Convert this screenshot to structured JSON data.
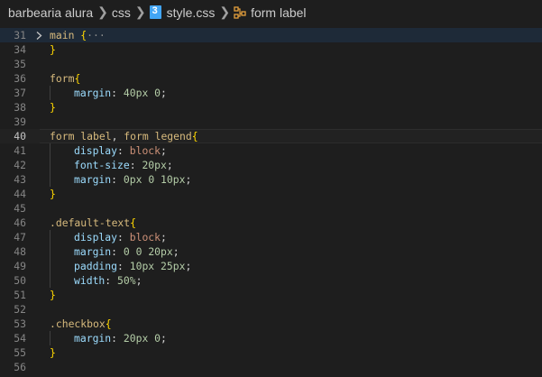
{
  "breadcrumb": {
    "folder": "barbearia alura",
    "subfolder": "css",
    "file": "style.css",
    "symbol": "form label"
  },
  "editor": {
    "lines": [
      {
        "n": "31",
        "folded": true,
        "tokens": [
          [
            "sel",
            "main"
          ],
          [
            "punc",
            " "
          ],
          [
            "br",
            "{"
          ],
          [
            "ell",
            "···"
          ]
        ]
      },
      {
        "n": "34",
        "tokens": [
          [
            "br",
            "}"
          ]
        ]
      },
      {
        "n": "35",
        "tokens": []
      },
      {
        "n": "36",
        "tokens": [
          [
            "sel",
            "form"
          ],
          [
            "br",
            "{"
          ]
        ]
      },
      {
        "n": "37",
        "indent": 1,
        "tokens": [
          [
            "prop",
            "margin"
          ],
          [
            "punc",
            ": "
          ],
          [
            "num",
            "40px"
          ],
          [
            "punc",
            " "
          ],
          [
            "num",
            "0"
          ],
          [
            "punc",
            ";"
          ]
        ]
      },
      {
        "n": "38",
        "tokens": [
          [
            "br",
            "}"
          ]
        ]
      },
      {
        "n": "39",
        "tokens": []
      },
      {
        "n": "40",
        "current": true,
        "tokens": [
          [
            "sel",
            "form label"
          ],
          [
            "punc",
            ", "
          ],
          [
            "sel",
            "form legend"
          ],
          [
            "br",
            "{"
          ]
        ]
      },
      {
        "n": "41",
        "indent": 1,
        "tokens": [
          [
            "prop",
            "display"
          ],
          [
            "punc",
            ": "
          ],
          [
            "val",
            "block"
          ],
          [
            "punc",
            ";"
          ]
        ]
      },
      {
        "n": "42",
        "indent": 1,
        "tokens": [
          [
            "prop",
            "font-size"
          ],
          [
            "punc",
            ": "
          ],
          [
            "num",
            "20px"
          ],
          [
            "punc",
            ";"
          ]
        ]
      },
      {
        "n": "43",
        "indent": 1,
        "tokens": [
          [
            "prop",
            "margin"
          ],
          [
            "punc",
            ": "
          ],
          [
            "num",
            "0px"
          ],
          [
            "punc",
            " "
          ],
          [
            "num",
            "0"
          ],
          [
            "punc",
            " "
          ],
          [
            "num",
            "10px"
          ],
          [
            "punc",
            ";"
          ]
        ]
      },
      {
        "n": "44",
        "tokens": [
          [
            "br",
            "}"
          ]
        ]
      },
      {
        "n": "45",
        "tokens": []
      },
      {
        "n": "46",
        "tokens": [
          [
            "sel",
            ".default-text"
          ],
          [
            "br",
            "{"
          ]
        ]
      },
      {
        "n": "47",
        "indent": 1,
        "tokens": [
          [
            "prop",
            "display"
          ],
          [
            "punc",
            ": "
          ],
          [
            "val",
            "block"
          ],
          [
            "punc",
            ";"
          ]
        ]
      },
      {
        "n": "48",
        "indent": 1,
        "tokens": [
          [
            "prop",
            "margin"
          ],
          [
            "punc",
            ": "
          ],
          [
            "num",
            "0"
          ],
          [
            "punc",
            " "
          ],
          [
            "num",
            "0"
          ],
          [
            "punc",
            " "
          ],
          [
            "num",
            "20px"
          ],
          [
            "punc",
            ";"
          ]
        ]
      },
      {
        "n": "49",
        "indent": 1,
        "tokens": [
          [
            "prop",
            "padding"
          ],
          [
            "punc",
            ": "
          ],
          [
            "num",
            "10px"
          ],
          [
            "punc",
            " "
          ],
          [
            "num",
            "25px"
          ],
          [
            "punc",
            ";"
          ]
        ]
      },
      {
        "n": "50",
        "indent": 1,
        "tokens": [
          [
            "prop",
            "width"
          ],
          [
            "punc",
            ": "
          ],
          [
            "num",
            "50%"
          ],
          [
            "punc",
            ";"
          ]
        ]
      },
      {
        "n": "51",
        "tokens": [
          [
            "br",
            "}"
          ]
        ]
      },
      {
        "n": "52",
        "tokens": []
      },
      {
        "n": "53",
        "tokens": [
          [
            "sel",
            ".checkbox"
          ],
          [
            "br",
            "{"
          ]
        ]
      },
      {
        "n": "54",
        "indent": 1,
        "tokens": [
          [
            "prop",
            "margin"
          ],
          [
            "punc",
            ": "
          ],
          [
            "num",
            "20px"
          ],
          [
            "punc",
            " "
          ],
          [
            "num",
            "0"
          ],
          [
            "punc",
            ";"
          ]
        ]
      },
      {
        "n": "55",
        "tokens": [
          [
            "br",
            "}"
          ]
        ]
      },
      {
        "n": "56",
        "tokens": []
      }
    ]
  }
}
